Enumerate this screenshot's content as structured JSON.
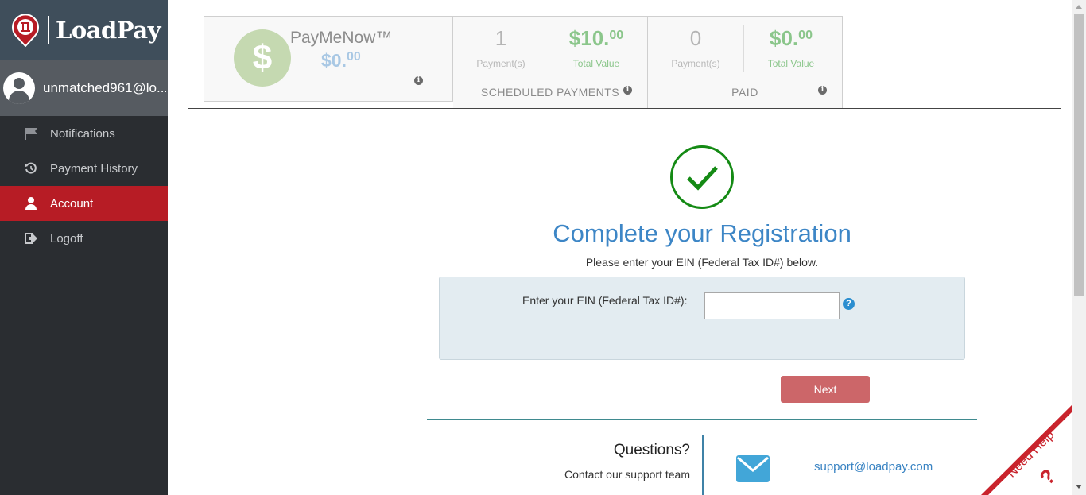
{
  "sidebar": {
    "brand": "LoadPay",
    "user": "unmatched961@lo...",
    "items": [
      {
        "label": "Notifications",
        "icon": "flag-icon"
      },
      {
        "label": "Payment History",
        "icon": "history-icon"
      },
      {
        "label": "Account",
        "icon": "user-icon",
        "active": true
      },
      {
        "label": "Logoff",
        "icon": "logoff-icon"
      }
    ]
  },
  "stats": {
    "paymenow": {
      "title": "PayMeNow™",
      "amount_main": "$0.",
      "amount_cents": "00"
    },
    "scheduled": {
      "count": "1",
      "count_label": "Payment(s)",
      "value_main": "$10.",
      "value_cents": "00",
      "value_label": "Total Value",
      "caption": "SCHEDULED PAYMENTS"
    },
    "paid": {
      "count": "0",
      "count_label": "Payment(s)",
      "value_main": "$0.",
      "value_cents": "00",
      "value_label": "Total Value",
      "caption": "PAID"
    }
  },
  "main": {
    "headline": "Complete your Registration",
    "subline": "Please enter your EIN (Federal Tax ID#) below.",
    "ein_label": "Enter your EIN (Federal Tax ID#):",
    "ein_value": "",
    "next_label": "Next"
  },
  "support": {
    "title": "Questions?",
    "subtitle": "Contact our support team",
    "email": "support@loadpay.com"
  },
  "need_help": {
    "label": "Need Help",
    "glyph": "?"
  },
  "colors": {
    "sidebar": "#2a2d31",
    "active": "#b71c25",
    "accent": "#3d86c6",
    "success": "#148a14",
    "next": "#cc6669"
  }
}
